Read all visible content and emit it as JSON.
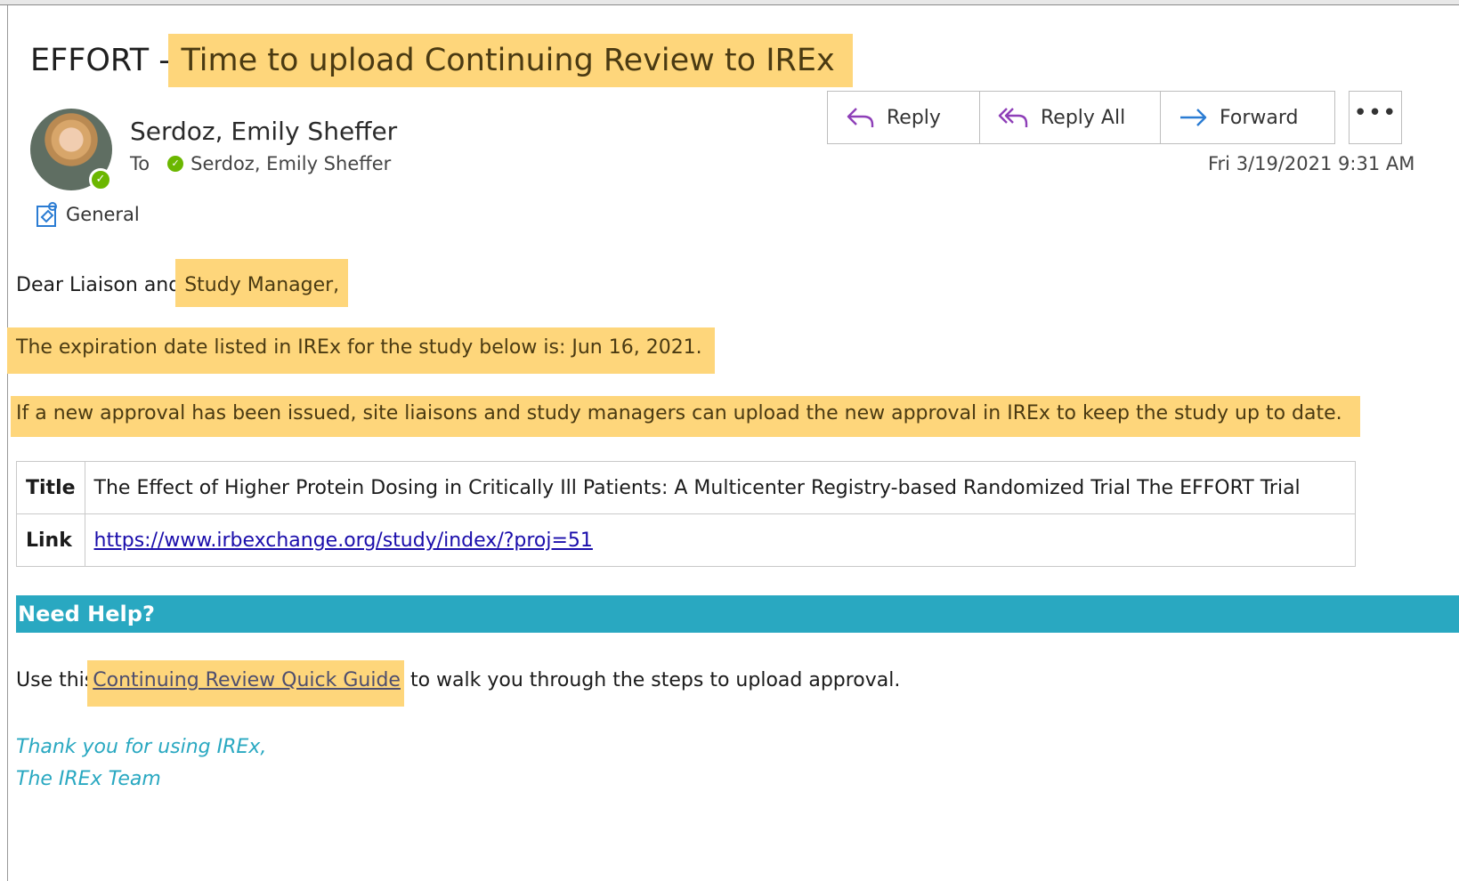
{
  "email": {
    "subject_prefix": "EFFORT --",
    "subject_highlight": " Time to upload Continuing Review to IREx",
    "sender": "Serdoz, Emily Sheffer",
    "to_label": "To",
    "recipient": "Serdoz, Emily Sheffer",
    "category": "General",
    "datetime": "Fri 3/19/2021 9:31 AM"
  },
  "actions": {
    "reply": "Reply",
    "reply_all": "Reply All",
    "forward": "Forward",
    "more": "•••"
  },
  "body": {
    "greeting_plain": "Dear Liaison and",
    "greeting_highlight": "Study Manager,",
    "expiration": "The expiration date listed in IREx for the study below is: Jun 16, 2021.",
    "instruction": "If a new approval has been issued, site liaisons and study managers can upload the new approval in IREx to keep the study up to date.",
    "table": [
      {
        "key": "Title",
        "value": "The Effect of Higher Protein Dosing in Critically Ill Patients: A Multicenter Registry-based Randomized Trial The EFFORT Trial"
      },
      {
        "key": "Link",
        "value": "https://www.irbexchange.org/study/index/?proj=51"
      }
    ],
    "help_heading": "Need Help?",
    "guide_before": "Use this",
    "guide_link": "Continuing Review Quick Guide",
    "guide_after": " to walk you through the steps to upload approval.",
    "signoff_1": "Thank you for using IREx,",
    "signoff_2": "The IREx Team"
  },
  "colors": {
    "highlight": "#fed67b",
    "help_bar": "#29a8c1",
    "presence": "#6bb700",
    "link": "#1a0dab"
  }
}
